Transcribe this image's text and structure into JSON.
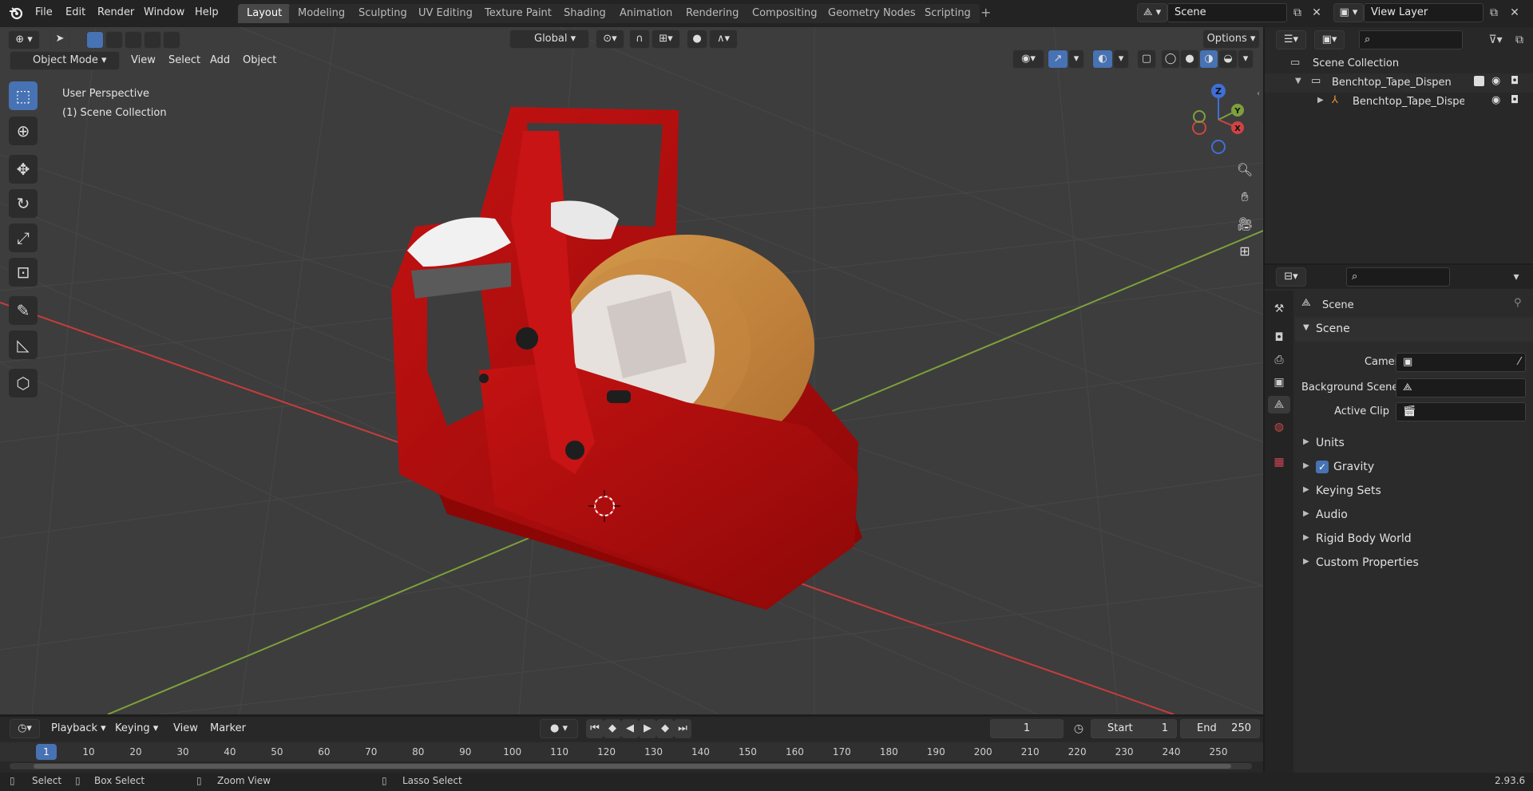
{
  "menubar": {
    "items": [
      "File",
      "Edit",
      "Render",
      "Window",
      "Help"
    ],
    "workspaces": [
      "Layout",
      "Modeling",
      "Sculpting",
      "UV Editing",
      "Texture Paint",
      "Shading",
      "Animation",
      "Rendering",
      "Compositing",
      "Geometry Nodes",
      "Scripting"
    ],
    "active_workspace": "Layout",
    "add_tab": "+",
    "scene": "Scene",
    "view_layer": "View Layer"
  },
  "viewport": {
    "mode": "Object Mode",
    "menus": [
      "View",
      "Select",
      "Add",
      "Object"
    ],
    "transform_orientation": "Global",
    "options_label": "Options",
    "overlay_line1": "User Perspective",
    "overlay_line2": "(1) Scene Collection",
    "gizmo": {
      "z": "Z",
      "y": "Y",
      "x": "X"
    },
    "tools": [
      "select-box",
      "cursor",
      "move",
      "rotate",
      "scale",
      "transform",
      "annotate",
      "measure",
      "add-cube"
    ]
  },
  "outliner": {
    "root": "Scene Collection",
    "items": [
      {
        "label": "Benchtop_Tape_Dispenser_wi",
        "level": 1
      },
      {
        "label": "Benchtop_Tape_Dispense",
        "level": 2
      }
    ]
  },
  "properties": {
    "context_title": "Scene",
    "section_scene": "Scene",
    "camera_label": "Camera",
    "background_scene_label": "Background Scene",
    "active_clip_label": "Active Clip",
    "panels": [
      "Units",
      "Gravity",
      "Keying Sets",
      "Audio",
      "Rigid Body World",
      "Custom Properties"
    ],
    "gravity_checked": true
  },
  "timeline": {
    "menus": [
      "Playback",
      "Keying",
      "View",
      "Marker"
    ],
    "current_frame": "1",
    "start_label": "Start",
    "start_value": "1",
    "end_label": "End",
    "end_value": "250",
    "ruler": [
      "1",
      "10",
      "20",
      "30",
      "40",
      "50",
      "60",
      "70",
      "80",
      "90",
      "100",
      "110",
      "120",
      "130",
      "140",
      "150",
      "160",
      "170",
      "180",
      "190",
      "200",
      "210",
      "220",
      "230",
      "240",
      "250"
    ]
  },
  "statusbar": {
    "select": "Select",
    "box_select": "Box Select",
    "zoom_view": "Zoom View",
    "lasso_select": "Lasso Select",
    "version": "2.93.6"
  },
  "colors": {
    "accent": "#4772b3",
    "dispenser_red": "#b01010",
    "tape_orange": "#c98a3c",
    "x_axis": "#c83c3c",
    "y_axis": "#7ea03c"
  }
}
